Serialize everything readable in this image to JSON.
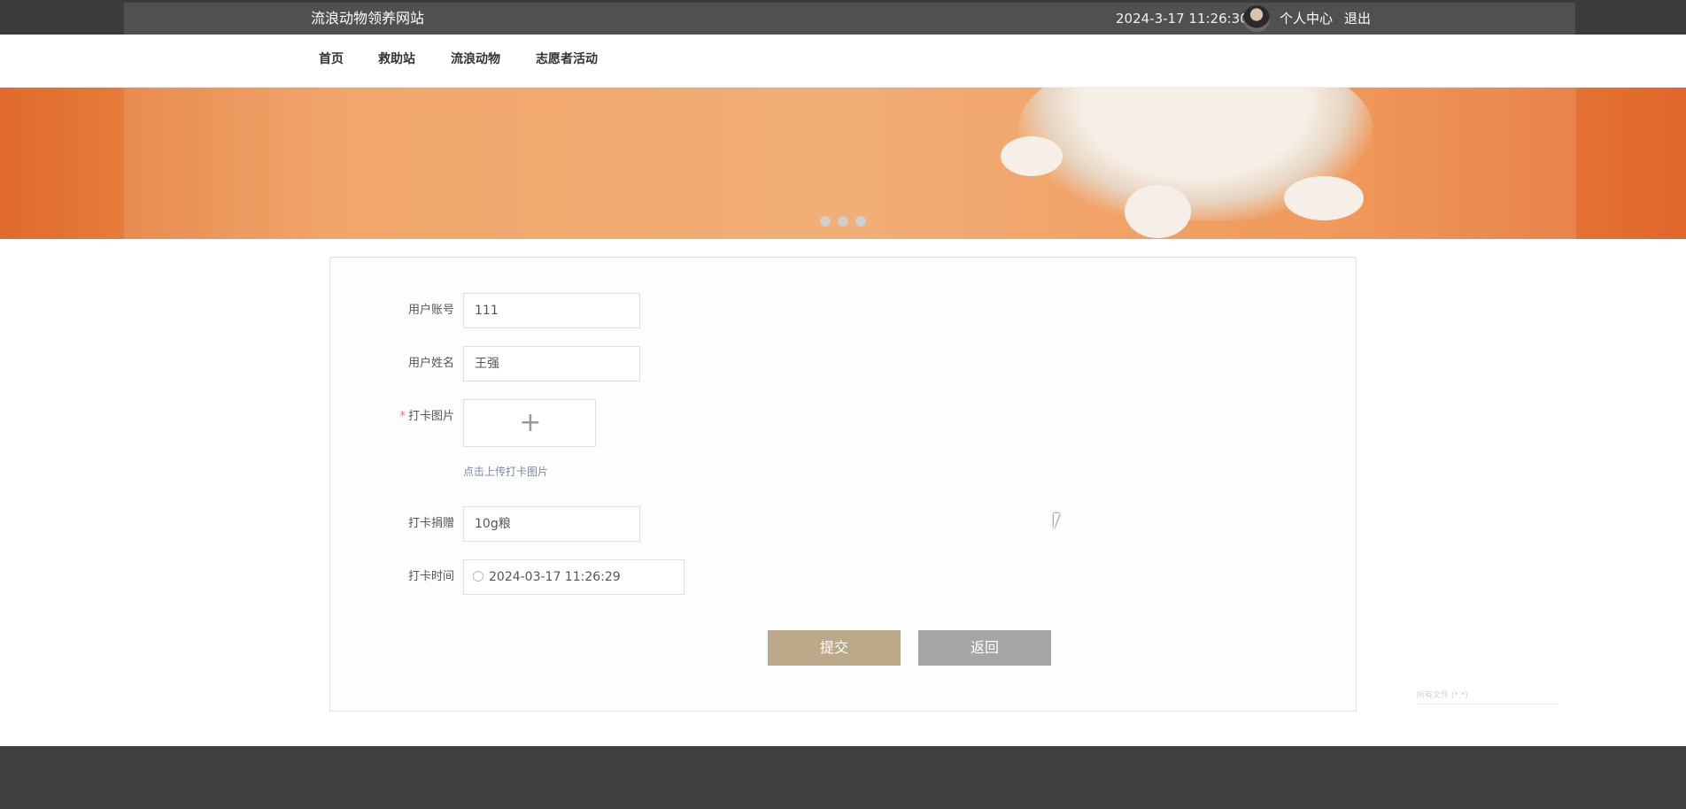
{
  "header": {
    "site_title": "流浪动物领养网站",
    "datetime": "2024-3-17 11:26:30",
    "user_center": "个人中心",
    "logout": "退出"
  },
  "nav": {
    "items": [
      "首页",
      "救助站",
      "流浪动物",
      "志愿者活动"
    ]
  },
  "banner": {
    "slide_count": 3
  },
  "form": {
    "account_label": "用户账号",
    "account_value": "111",
    "name_label": "用户姓名",
    "name_value": "王强",
    "image_label": "打卡图片",
    "image_required": "*",
    "upload_icon": "plus-icon",
    "upload_glyph": "+",
    "upload_hint": "点击上传打卡图片",
    "donation_label": "打卡捐赠",
    "donation_value": "10g粮",
    "time_label": "打卡时间",
    "time_value": "2024-03-17 11:26:29",
    "time_icon": "clock-icon"
  },
  "actions": {
    "submit": "提交",
    "back": "返回"
  },
  "file_filter": "所有文件 (*.*)",
  "colors": {
    "topbar": "#3c3c3c",
    "submit_button": "#bba989",
    "back_button": "#a5a5a5",
    "footer": "#3f3f3f",
    "required": "#f56c6c"
  }
}
